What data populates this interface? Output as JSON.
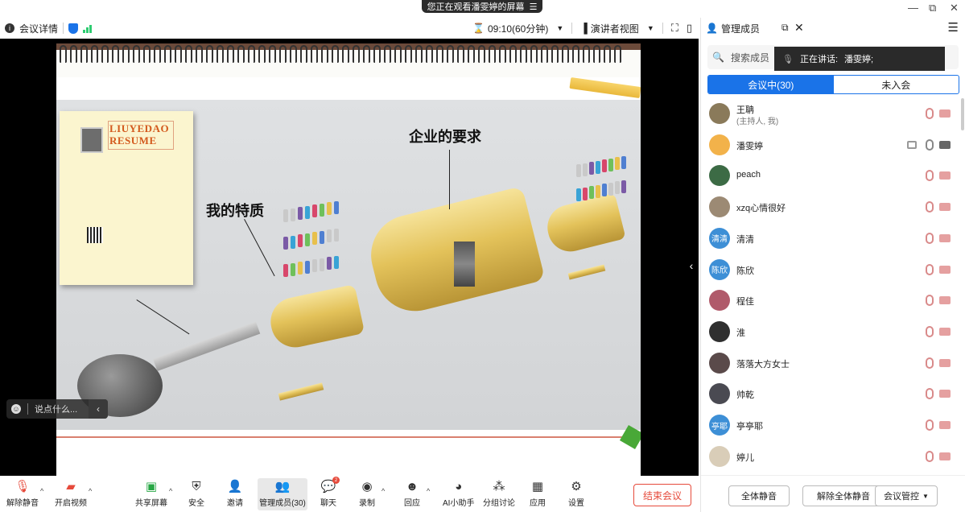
{
  "banner": {
    "text": "您正在观看潘雯婷的屏幕",
    "icon": "list-icon"
  },
  "window_controls": {
    "minimize": "—",
    "maximize": "⧉",
    "close": "✕"
  },
  "header": {
    "details_label": "会议详情",
    "timer": "09:10(60分钟)",
    "view_label": "演讲者视图"
  },
  "slide": {
    "caption_traits": "我的特质",
    "caption_requirements": "企业的要求",
    "resume_title_1": "LIUYEDAO",
    "resume_title_2": "RESUME"
  },
  "chat": {
    "placeholder": "说点什么..."
  },
  "toolbar": {
    "unmute": "解除静音",
    "start_video": "开启视频",
    "share_screen": "共享屏幕",
    "security": "安全",
    "invite": "邀请",
    "manage_members": "管理成员(30)",
    "chat": "聊天",
    "chat_badge": "2",
    "record": "录制",
    "reactions": "回应",
    "ai_assistant": "AI小助手",
    "breakout": "分组讨论",
    "apps": "应用",
    "settings": "设置",
    "end_meeting": "结束会议"
  },
  "panel": {
    "title": "管理成员",
    "search_placeholder": "搜索成员",
    "speaking_label": "正在讲话:",
    "speaking_name": "潘雯婷;",
    "tab_in_meeting": "会议中(30)",
    "tab_not_joined": "未入会",
    "members": [
      {
        "name": "王聃",
        "sub": "(主持人, 我)",
        "avatar_text": "",
        "avatar_color": "#8a7a5a"
      },
      {
        "name": "潘雯婷",
        "sub": "",
        "avatar_text": "",
        "avatar_color": "#f2b24a"
      },
      {
        "name": "peach",
        "sub": "",
        "avatar_text": "",
        "avatar_color": "#3c6b45"
      },
      {
        "name": "xzq心情很好",
        "sub": "",
        "avatar_text": "",
        "avatar_color": "#9c8a74"
      },
      {
        "name": "清清",
        "sub": "",
        "avatar_text": "清清",
        "avatar_color": "#3d8fd6"
      },
      {
        "name": "陈欣",
        "sub": "",
        "avatar_text": "陈欣",
        "avatar_color": "#3d8fd6"
      },
      {
        "name": "程佳",
        "sub": "",
        "avatar_text": "",
        "avatar_color": "#b05a6a"
      },
      {
        "name": "淮",
        "sub": "",
        "avatar_text": "",
        "avatar_color": "#2f2f2f"
      },
      {
        "name": "落落大方女士",
        "sub": "",
        "avatar_text": "",
        "avatar_color": "#5a4a4a"
      },
      {
        "name": "帅乾",
        "sub": "",
        "avatar_text": "",
        "avatar_color": "#4a4a52"
      },
      {
        "name": "亭亭耶",
        "sub": "",
        "avatar_text": "亭耶",
        "avatar_color": "#3d8fd6"
      },
      {
        "name": "婷儿",
        "sub": "",
        "avatar_text": "",
        "avatar_color": "#d9cdb8"
      }
    ],
    "mute_all": "全体静音",
    "unmute_all": "解除全体静音",
    "meeting_control": "会议管控"
  }
}
